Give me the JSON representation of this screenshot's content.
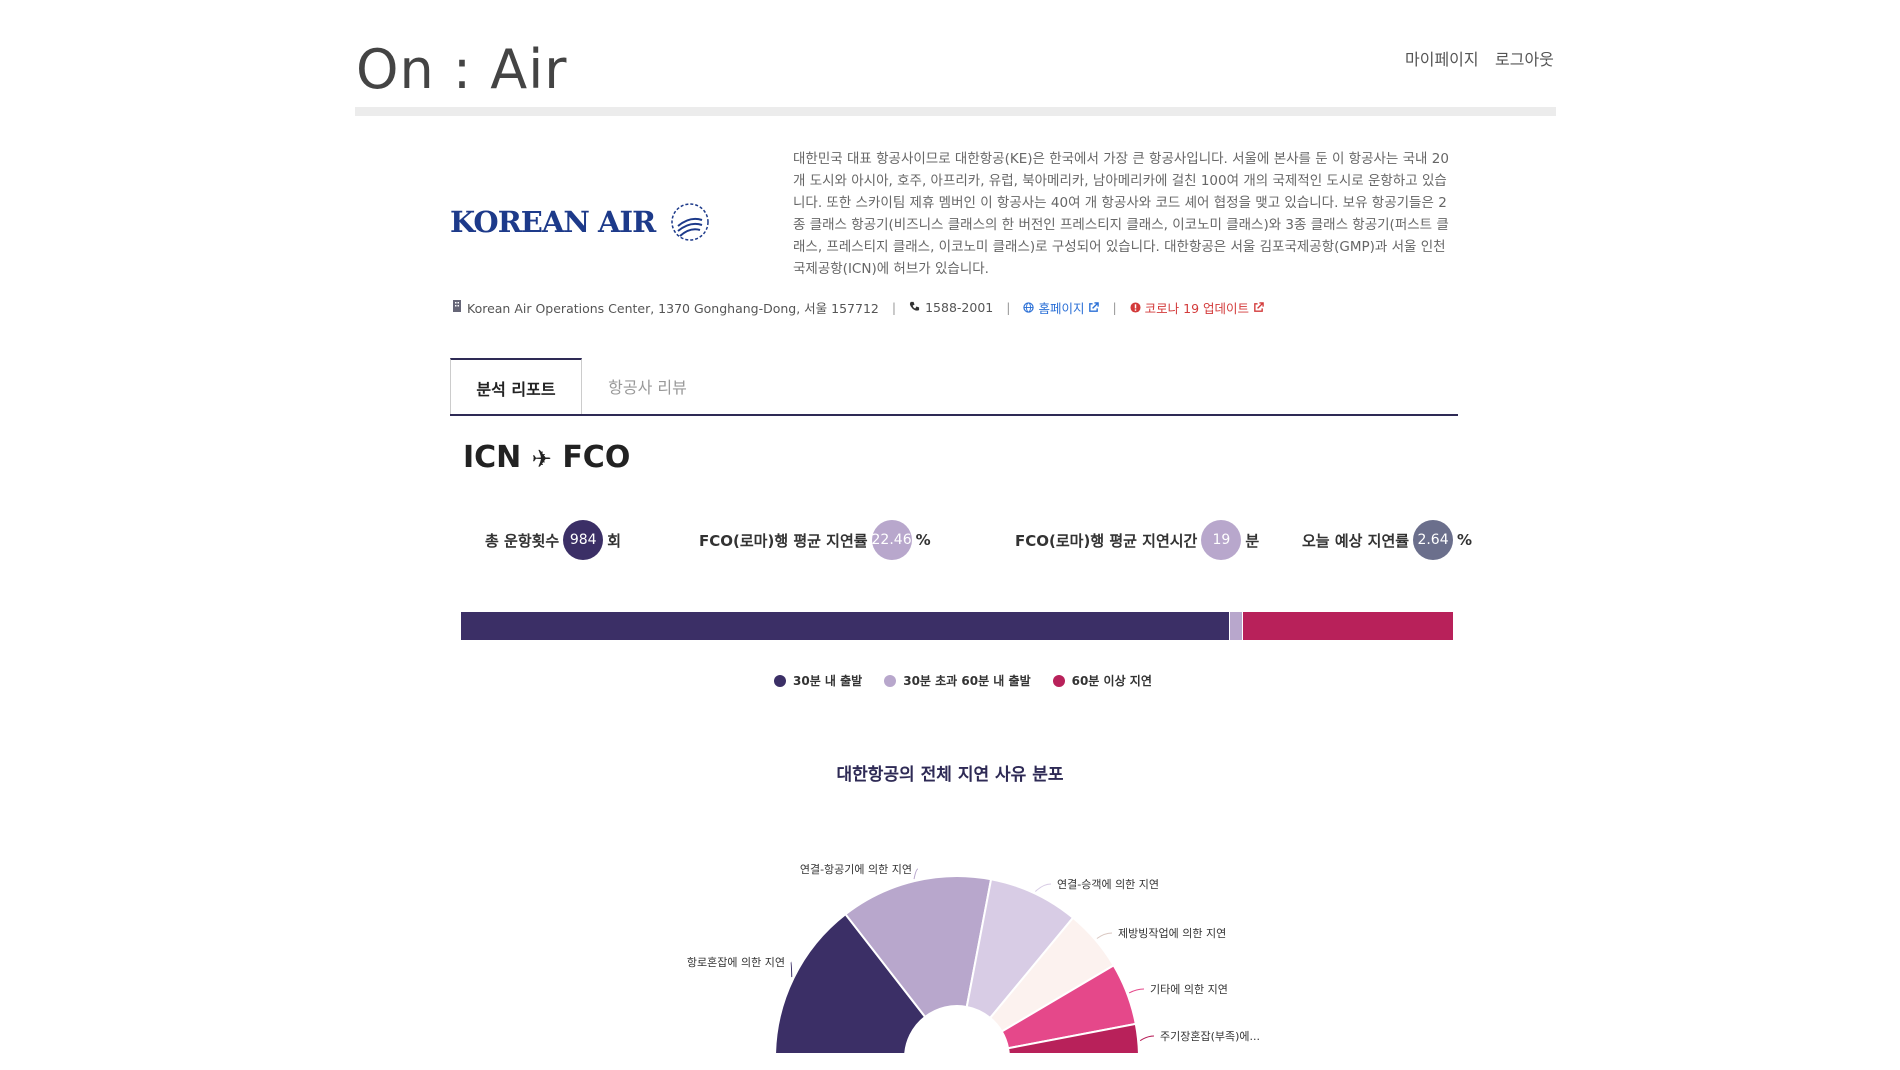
{
  "header": {
    "logo_text": "On : Air",
    "nav": {
      "mypage": "마이페이지",
      "logout": "로그아웃"
    }
  },
  "airline": {
    "logo_text": "KOREAN AIR",
    "description": "대한민국 대표 항공사이므로 대한항공(KE)은 한국에서 가장 큰 항공사입니다. 서울에 본사를 둔 이 항공사는 국내 20개 도시와 아시아, 호주, 아프리카, 유럽, 북아메리카, 남아메리카에 걸친 100여 개의 국제적인 도시로 운항하고 있습니다. 또한 스카이팀 제휴 멤버인 이 항공사는 40여 개 항공사와 코드 셰어 협정을 맺고 있습니다. 보유 항공기들은 2종 클래스 항공기(비즈니스 클래스의 한 버전인 프레스티지 클래스, 이코노미 클래스)와 3종 클래스 항공기(퍼스트 클래스, 프레스티지 클래스, 이코노미 클래스)로 구성되어 있습니다. 대한항공은 서울 김포국제공항(GMP)과 서울 인천국제공항(ICN)에 허브가 있습니다.",
    "address": "Korean Air Operations Center, 1370 Gonghang-Dong, 서울 157712",
    "phone": "1588-2001",
    "homepage_label": "홈페이지",
    "covid_label": "코로나 19 업데이트"
  },
  "tabs": [
    {
      "label": "분석 리포트",
      "active": true
    },
    {
      "label": "항공사 리뷰",
      "active": false
    }
  ],
  "route": {
    "origin": "ICN",
    "destination": "FCO",
    "arrow": "✈"
  },
  "stats": [
    {
      "label": "총 운항횟수",
      "value": "984",
      "unit": "회",
      "color": "#3b2f66"
    },
    {
      "label": "FCO(로마)행 평균 지연률",
      "value": "22.46",
      "unit": "%",
      "color": "#b8a7cc"
    },
    {
      "label": "FCO(로마)행 평균 지연시간",
      "value": "19",
      "unit": "분",
      "color": "#b8a7cc"
    },
    {
      "label": "오늘 예상 지연률",
      "value": "2.64",
      "unit": "%",
      "color": "#6b6f8c"
    }
  ],
  "delay_bar": {
    "segments": [
      {
        "label": "30분 내 출발",
        "share": 0.776,
        "color": "#3b2f66"
      },
      {
        "label": "30분 초과 60분 내 출발",
        "share": 0.012,
        "color": "#b8a7cc"
      },
      {
        "label": "60분 이상 지연",
        "share": 0.212,
        "color": "#b8215a"
      }
    ]
  },
  "pie": {
    "title": "대한항공의 전체 지연 사유 분포",
    "slices": [
      {
        "label": "항로혼잡에 의한 지연",
        "value": 29,
        "color": "#3b2f66"
      },
      {
        "label": "연결-항공기에 의한 지연",
        "value": 27,
        "color": "#b8a7cc"
      },
      {
        "label": "연결-승객에 의한 지연",
        "value": 16,
        "color": "#d8cce5"
      },
      {
        "label": "제방빙작업에 의한 지연",
        "value": 11,
        "color": "#fcf2ef"
      },
      {
        "label": "기타에 의한 지연",
        "value": 11,
        "color": "#e5488a"
      },
      {
        "label": "주기장혼잡(부족)에...",
        "value": 6,
        "color": "#b8215a"
      }
    ]
  },
  "colors": {
    "brand_dark": "#2e2a55",
    "accent_blue": "#2a6fd6",
    "alert_red": "#d33a3a"
  }
}
